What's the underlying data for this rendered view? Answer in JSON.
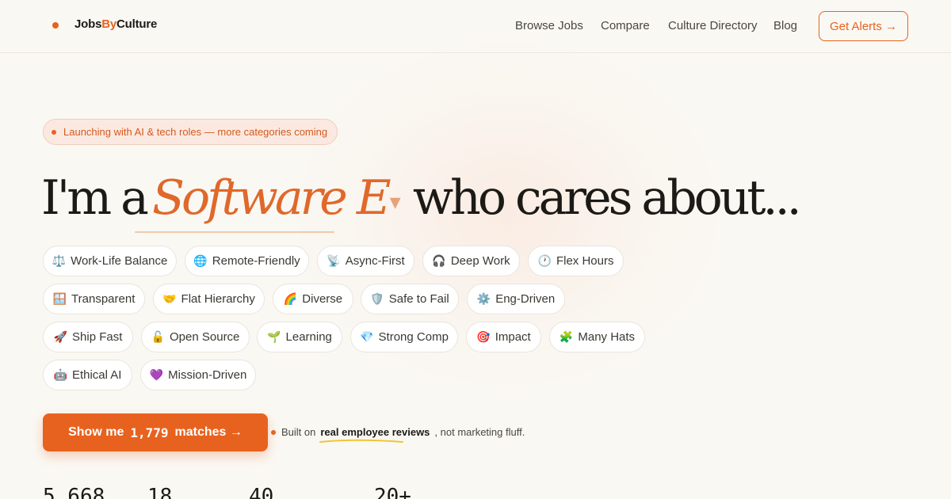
{
  "brand": {
    "pre": "Jobs",
    "accent": "By",
    "post": "Culture",
    "accent_color": "#e8621f"
  },
  "nav": [
    {
      "label": "Browse Jobs"
    },
    {
      "label": "Compare"
    },
    {
      "label": "Culture Directory"
    },
    {
      "label": "Blog"
    }
  ],
  "alerts_button": "Get Alerts →",
  "badge": "Launching with AI & tech roles — more categories coming",
  "headline": {
    "prefix": "I'm a",
    "role": "Software E",
    "caret": "▾",
    "suffix": "who cares about..."
  },
  "chips": [
    {
      "icon": "⚖️",
      "icon_name": "scales-icon",
      "label": "Work-Life Balance"
    },
    {
      "icon": "🌐",
      "icon_name": "globe-icon",
      "label": "Remote-Friendly"
    },
    {
      "icon": "📡",
      "icon_name": "satellite-icon",
      "label": "Async-First"
    },
    {
      "icon": "🎧",
      "icon_name": "headphones-icon",
      "label": "Deep Work"
    },
    {
      "icon": "🕐",
      "icon_name": "clock-icon",
      "label": "Flex Hours"
    },
    {
      "icon": "🪟",
      "icon_name": "window-icon",
      "label": "Transparent"
    },
    {
      "icon": "🤝",
      "icon_name": "handshake-icon",
      "label": "Flat Hierarchy"
    },
    {
      "icon": "🌈",
      "icon_name": "rainbow-icon",
      "label": "Diverse"
    },
    {
      "icon": "🛡️",
      "icon_name": "shield-icon",
      "label": "Safe to Fail"
    },
    {
      "icon": "⚙️",
      "icon_name": "gear-icon",
      "label": "Eng-Driven"
    },
    {
      "icon": "🚀",
      "icon_name": "rocket-icon",
      "label": "Ship Fast"
    },
    {
      "icon": "🔓",
      "icon_name": "unlock-icon",
      "label": "Open Source"
    },
    {
      "icon": "🌱",
      "icon_name": "seedling-icon",
      "label": "Learning"
    },
    {
      "icon": "💎",
      "icon_name": "gem-icon",
      "label": "Strong Comp"
    },
    {
      "icon": "🎯",
      "icon_name": "target-icon",
      "label": "Impact"
    },
    {
      "icon": "🧩",
      "icon_name": "puzzle-icon",
      "label": "Many Hats"
    },
    {
      "icon": "🤖",
      "icon_name": "robot-icon",
      "label": "Ethical AI"
    },
    {
      "icon": "💜",
      "icon_name": "purple-heart-icon",
      "label": "Mission-Driven"
    }
  ],
  "cta": {
    "prefix": "Show me",
    "count": "1,779",
    "suffix": "matches →"
  },
  "built": {
    "prefix": "Built on",
    "strong": "real employee reviews",
    "suffix": ", not marketing fluff."
  },
  "stats": [
    "5,668",
    "18",
    "40",
    "20+"
  ]
}
